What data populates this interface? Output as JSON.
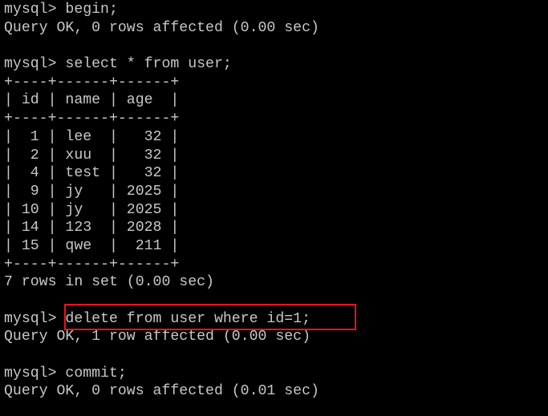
{
  "terminal": {
    "lines": [
      "mysql> begin;",
      "Query OK, 0 rows affected (0.00 sec)",
      "",
      "mysql> select * from user;",
      "+----+------+------+",
      "| id | name | age  |",
      "+----+------+------+",
      "|  1 | lee  |   32 |",
      "|  2 | xuu  |   32 |",
      "|  4 | test |   32 |",
      "|  9 | jy   | 2025 |",
      "| 10 | jy   | 2025 |",
      "| 14 | 123  | 2028 |",
      "| 15 | qwe  |  211 |",
      "+----+------+------+",
      "7 rows in set (0.00 sec)",
      "",
      "mysql> delete from user where id=1;",
      "Query OK, 1 row affected (0.00 sec)",
      "",
      "mysql> commit;",
      "Query OK, 0 rows affected (0.01 sec)"
    ]
  },
  "colors": {
    "background": "#000000",
    "text": "#c7c7c7",
    "highlight_border": "#e8141d"
  }
}
